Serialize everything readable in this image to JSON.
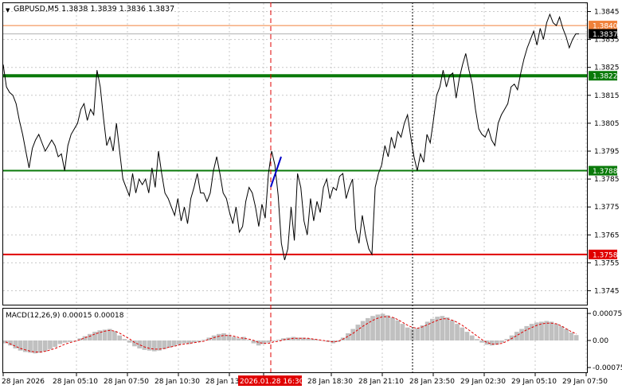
{
  "header": {
    "collapse_glyph": "▼",
    "title": "GBPUSD,M5  1.3838 1.3839 1.3836 1.3837"
  },
  "macd": {
    "title": "MACD(12,26,9) 0.00015 0.00018",
    "ticks": [
      "0.00075",
      "0.00",
      "-0.00075"
    ]
  },
  "price_axis": {
    "ticks": [
      "1.3845",
      "1.3835",
      "1.3825",
      "1.3815",
      "1.3805",
      "1.3795",
      "1.3785",
      "1.3775",
      "1.3765",
      "1.3755",
      "1.3745"
    ]
  },
  "time_axis": {
    "labels": [
      "28 Jan 2026",
      "28 Jan 05:10",
      "28 Jan 07:50",
      "28 Jan 10:30",
      "28 Jan 13",
      "2026.01.28 16:30",
      "28 Jan 18:30",
      "28 Jan 21:10",
      "28 Jan 23:50",
      "29 Jan 02:30",
      "29 Jan 05:10",
      "29 Jan 07:50"
    ],
    "highlighted": "2026.01.28 16:30"
  },
  "levels": [
    {
      "value": 1.384,
      "label": "1.3840",
      "color": "#f0813a",
      "kind": "ask"
    },
    {
      "value": 1.3837,
      "label": "1.3837",
      "color": "#000000",
      "kind": "bid"
    },
    {
      "value": 1.3822,
      "label": "1.3822",
      "color": "#0a7a0a",
      "kind": "resistance"
    },
    {
      "value": 1.3788,
      "label": "1.3788",
      "color": "#0a7a0a",
      "kind": "support"
    },
    {
      "value": 1.3758,
      "label": "1.3758",
      "color": "#e00000",
      "kind": "stop"
    }
  ],
  "colors": {
    "price_line": "#000000",
    "macd_hist": "#c0c0c0",
    "macd_signal": "#e00000",
    "grid": "#c8c8c8",
    "crosshair": "#e00000",
    "trend_segment": "#0000c8"
  },
  "chart_data": [
    {
      "type": "line",
      "title": "GBPUSD,M5",
      "x_labels": [
        "28 Jan 2026",
        "28 Jan 05:10",
        "28 Jan 07:50",
        "28 Jan 10:30",
        "28 Jan 13",
        "2026.01.28 16:30",
        "28 Jan 18:30",
        "28 Jan 21:10",
        "28 Jan 23:50",
        "29 Jan 02:30",
        "29 Jan 05:10",
        "29 Jan 07:50"
      ],
      "ylim": [
        1.374,
        1.3848
      ],
      "grid": true,
      "series": [
        {
          "values": [
            1.3826,
            1.3818,
            1.3816,
            1.3815,
            1.3812,
            1.3806,
            1.3801,
            1.3795,
            1.3789,
            1.3796,
            1.3799,
            1.3801,
            1.3798,
            1.3795,
            1.3797,
            1.3799,
            1.3797,
            1.3793,
            1.3794,
            1.3788,
            1.3797,
            1.3801,
            1.3803,
            1.3805,
            1.381,
            1.3812,
            1.3806,
            1.381,
            1.3808,
            1.3824,
            1.3818,
            1.3807,
            1.3797,
            1.38,
            1.3795,
            1.3805,
            1.3795,
            1.3785,
            1.3782,
            1.3779,
            1.3787,
            1.378,
            1.3785,
            1.3783,
            1.3785,
            1.378,
            1.3789,
            1.3782,
            1.3795,
            1.3787,
            1.378,
            1.3778,
            1.3775,
            1.3772,
            1.3778,
            1.377,
            1.3775,
            1.3769,
            1.3778,
            1.3782,
            1.3787,
            1.378,
            1.378,
            1.3777,
            1.378,
            1.3788,
            1.3793,
            1.3787,
            1.378,
            1.3778,
            1.3773,
            1.3769,
            1.3775,
            1.3766,
            1.3768,
            1.3777,
            1.3782,
            1.378,
            1.3775,
            1.3768,
            1.3776,
            1.3771,
            1.3787,
            1.3795,
            1.379,
            1.3779,
            1.3762,
            1.3756,
            1.376,
            1.3775,
            1.3763,
            1.3787,
            1.3782,
            1.377,
            1.3765,
            1.3778,
            1.377,
            1.3777,
            1.3773,
            1.3782,
            1.3785,
            1.3778,
            1.3782,
            1.3781,
            1.3786,
            1.3787,
            1.3778,
            1.3782,
            1.3785,
            1.3767,
            1.3762,
            1.3772,
            1.3765,
            1.376,
            1.3758,
            1.3782,
            1.3787,
            1.379,
            1.3797,
            1.3793,
            1.38,
            1.3796,
            1.3802,
            1.38,
            1.3805,
            1.3808,
            1.38,
            1.3793,
            1.3788,
            1.3794,
            1.3791,
            1.3801,
            1.3798,
            1.3806,
            1.3815,
            1.3818,
            1.3824,
            1.3818,
            1.3822,
            1.3823,
            1.3814,
            1.3821,
            1.3826,
            1.383,
            1.3824,
            1.3819,
            1.381,
            1.3803,
            1.3801,
            1.38,
            1.3803,
            1.3799,
            1.3797,
            1.3805,
            1.3808,
            1.381,
            1.3812,
            1.3818,
            1.3819,
            1.3817,
            1.3823,
            1.3828,
            1.3832,
            1.3835,
            1.3838,
            1.3833,
            1.3839,
            1.3835,
            1.3841,
            1.3844,
            1.3841,
            1.384,
            1.3843,
            1.3839,
            1.3836,
            1.3832,
            1.3835,
            1.3837,
            1.3837
          ]
        }
      ]
    },
    {
      "type": "bar",
      "title": "MACD(12,26,9) 0.00015 0.00018",
      "ylim": [
        -0.00075,
        0.00075
      ],
      "series": [
        {
          "name": "MACD",
          "values": [
            -8e-05,
            -0.00014,
            -0.00022,
            -0.00028,
            -0.00032,
            -0.00034,
            -0.00036,
            -0.00034,
            -0.0003,
            -0.00024,
            -0.00018,
            -0.0001,
            -6e-05,
            -4e-05,
            0.0,
            6e-05,
            0.00012,
            0.00018,
            0.00024,
            0.00028,
            0.0003,
            0.00032,
            0.00026,
            0.00014,
            4e-05,
            -6e-05,
            -0.00016,
            -0.00022,
            -0.00026,
            -0.00028,
            -0.0003,
            -0.00028,
            -0.00024,
            -0.0002,
            -0.00016,
            -0.00012,
            -8e-05,
            -0.0001,
            -6e-05,
            -4e-05,
            2e-05,
            8e-05,
            0.00014,
            0.00018,
            0.0002,
            0.00016,
            0.0001,
            6e-05,
            0.0001,
            2e-05,
            -8e-05,
            -0.00014,
            -0.0001,
            -6e-05,
            -2e-05,
            2e-05,
            6e-05,
            8e-05,
            0.0001,
            8e-05,
            8e-05,
            6e-05,
            4e-05,
            2e-05,
            0.0,
            -4e-05,
            -8e-05,
            -4e-05,
            8e-05,
            0.0002,
            0.00032,
            0.00044,
            0.00054,
            0.00062,
            0.00068,
            0.00072,
            0.00074,
            0.0007,
            0.00064,
            0.00056,
            0.00046,
            0.00036,
            0.00032,
            0.00034,
            0.00042,
            0.00052,
            0.0006,
            0.00066,
            0.00068,
            0.00064,
            0.00056,
            0.00046,
            0.00036,
            0.00024,
            0.00014,
            4e-05,
            -6e-05,
            -0.00012,
            -0.00014,
            -0.00012,
            -6e-05,
            4e-05,
            0.00014,
            0.00024,
            0.00032,
            0.0004,
            0.00046,
            0.0005,
            0.00052,
            0.00054,
            0.00052,
            0.00046,
            0.0004,
            0.00032,
            0.00022,
            0.00015
          ]
        },
        {
          "name": "Signal",
          "values": [
            -4e-05,
            -0.0001,
            -0.00016,
            -0.00022,
            -0.00026,
            -0.0003,
            -0.00032,
            -0.00032,
            -0.0003,
            -0.00026,
            -0.00022,
            -0.00016,
            -0.0001,
            -6e-05,
            -2e-05,
            2e-05,
            8e-05,
            0.00012,
            0.00018,
            0.00022,
            0.00026,
            0.00028,
            0.00026,
            0.0002,
            0.00012,
            4e-05,
            -6e-05,
            -0.00012,
            -0.00018,
            -0.00022,
            -0.00024,
            -0.00024,
            -0.00022,
            -0.00018,
            -0.00016,
            -0.00012,
            -0.0001,
            -8e-05,
            -6e-05,
            -4e-05,
            -2e-05,
            4e-05,
            8e-05,
            0.00012,
            0.00014,
            0.00014,
            0.00012,
            8e-05,
            6e-05,
            4e-05,
            0.0,
            -6e-05,
            -8e-05,
            -8e-05,
            -4e-05,
            -2e-05,
            2e-05,
            4e-05,
            6e-05,
            6e-05,
            6e-05,
            6e-05,
            4e-05,
            2e-05,
            0.0,
            -2e-05,
            -4e-05,
            -2e-05,
            4e-05,
            0.00012,
            0.0002,
            0.0003,
            0.0004,
            0.00048,
            0.00056,
            0.00062,
            0.00066,
            0.00066,
            0.00064,
            0.00058,
            0.0005,
            0.00042,
            0.00036,
            0.00034,
            0.00038,
            0.00044,
            0.0005,
            0.00056,
            0.0006,
            0.0006,
            0.00056,
            0.0005,
            0.00042,
            0.00032,
            0.00022,
            0.00012,
            2e-05,
            -6e-05,
            -0.0001,
            -0.0001,
            -8e-05,
            -2e-05,
            6e-05,
            0.00014,
            0.00022,
            0.0003,
            0.00036,
            0.00042,
            0.00046,
            0.00048,
            0.00048,
            0.00046,
            0.0004,
            0.00032,
            0.00024,
            0.00018
          ]
        }
      ]
    }
  ]
}
